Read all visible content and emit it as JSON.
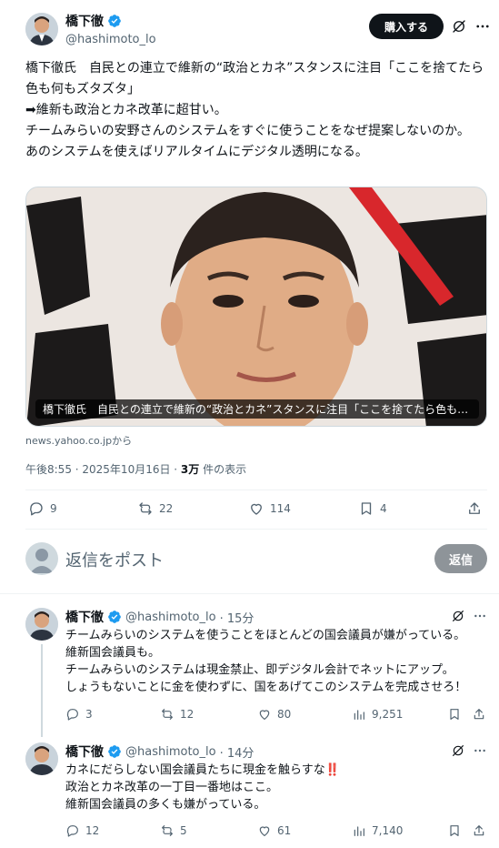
{
  "main_post": {
    "author_name": "橋下徹",
    "author_handle": "@hashimoto_lo",
    "buy_button": "購入する",
    "text": "橋下徹氏　自民との連立で維新の“政治とカネ”スタンスに注目「ここを捨てたら色も何もズタズタ」\n➡維新も政治とカネ改革に超甘い。\nチームみらいの安野さんのシステムをすぐに使うことをなぜ提案しないのか。\nあのシステムを使えばリアルタイムにデジタル透明になる。",
    "card_caption": "橋下徹氏　自民との連立で維新の“政治とカネ”スタンスに注目「ここを捨てたら色も何...",
    "card_source": "news.yahoo.co.jpから",
    "timestamp": "午後8:55 · 2025年10月16日 · ",
    "views_count": "3万",
    "views_label": " 件の表示",
    "replies": "9",
    "reposts": "22",
    "likes": "114",
    "bookmarks": "4"
  },
  "reply_box": {
    "placeholder": "返信をポスト",
    "button": "返信"
  },
  "replies": [
    {
      "author_name": "橋下徹",
      "author_handle": "@hashimoto_lo",
      "time": "· 15分",
      "text": "チームみらいのシステムを使うことをほとんどの国会議員が嫌がっている。\n維新国会議員も。\nチームみらいのシステムは現金禁止、即デジタル会計でネットにアップ。\nしょうもないことに金を使わずに、国をあげてこのシステムを完成させろ！",
      "replies": "3",
      "reposts": "12",
      "likes": "80",
      "views": "9,251"
    },
    {
      "author_name": "橋下徹",
      "author_handle": "@hashimoto_lo",
      "time": "· 14分",
      "text": "カネにだらしない国会議員たちに現金を触らすな‼️\n政治とカネ改革の一丁目一番地はここ。\n維新国会議員の多くも嫌がっている。",
      "replies": "12",
      "reposts": "5",
      "likes": "61",
      "views": "7,140"
    }
  ],
  "colors": {
    "verified": "#1d9bf0",
    "text_secondary": "#536471",
    "divider": "#eff3f4",
    "button_dark": "#0f1419",
    "reply_button_disabled": "#8e9499"
  },
  "icons": [
    "verified-badge-icon",
    "grok-icon",
    "more-icon",
    "reply-icon",
    "repost-icon",
    "like-icon",
    "views-icon",
    "bookmark-icon",
    "share-icon"
  ]
}
